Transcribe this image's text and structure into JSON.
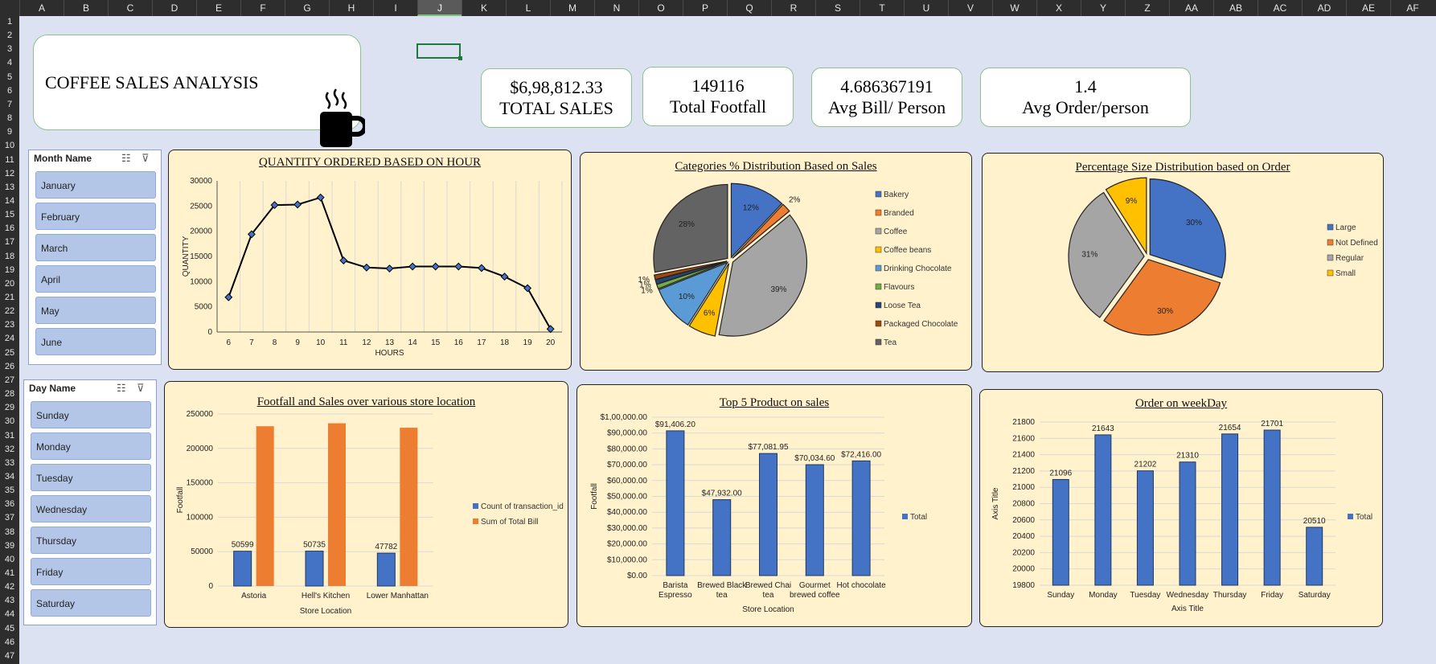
{
  "sheet": {
    "columns": [
      "A",
      "B",
      "C",
      "D",
      "E",
      "F",
      "G",
      "H",
      "I",
      "J",
      "K",
      "L",
      "M",
      "N",
      "O",
      "P",
      "Q",
      "R",
      "S",
      "T",
      "U",
      "V",
      "W",
      "X",
      "Y",
      "Z",
      "AA",
      "AB",
      "AC",
      "AD",
      "AE",
      "AF"
    ],
    "selected_column": "J",
    "rows": [
      "1",
      "2",
      "3",
      "4",
      "5",
      "6",
      "7",
      "8",
      "9",
      "10",
      "11",
      "12",
      "13",
      "14",
      "15",
      "16",
      "17",
      "18",
      "19",
      "20",
      "21",
      "22",
      "23",
      "24",
      "25",
      "26",
      "27",
      "28",
      "29",
      "30",
      "31",
      "32",
      "33",
      "34",
      "35",
      "36",
      "37",
      "38",
      "39",
      "40",
      "41",
      "42",
      "43",
      "44",
      "45",
      "46",
      "47"
    ]
  },
  "dashboard": {
    "title": "COFFEE SALES ANALYSIS",
    "icon": "coffee-mug-icon"
  },
  "kpis": [
    {
      "value": "$6,98,812.33",
      "label": "TOTAL SALES"
    },
    {
      "value": "149116",
      "label": "Total Footfall"
    },
    {
      "value": "4.686367191",
      "label": "Avg Bill/ Person"
    },
    {
      "value": "1.4",
      "label": "Avg Order/person"
    }
  ],
  "slicers": {
    "month": {
      "header": "Month Name",
      "items": [
        "January",
        "February",
        "March",
        "April",
        "May",
        "June"
      ]
    },
    "day": {
      "header": "Day Name",
      "items": [
        "Sunday",
        "Monday",
        "Tuesday",
        "Wednesday",
        "Thursday",
        "Friday",
        "Saturday"
      ]
    }
  },
  "colors": {
    "panel_bg": "#fff2cc",
    "blue": "#4472c4",
    "orange": "#ed7d31",
    "gray": "#a5a5a5",
    "yellow": "#ffc000",
    "light_blue": "#5b9bd5",
    "green": "#70ad47",
    "navy": "#264478",
    "dark_orange": "#9e480e",
    "dark_gray": "#636363"
  },
  "chart_data": [
    {
      "type": "line",
      "title": "QUANTITY ORDERED BASED ON HOUR",
      "xlabel": "HOURS",
      "ylabel": "QUANTITY",
      "x": [
        6,
        7,
        8,
        9,
        10,
        11,
        12,
        13,
        14,
        15,
        16,
        17,
        18,
        19,
        20
      ],
      "y": [
        6900,
        19400,
        25200,
        25300,
        26700,
        14200,
        12800,
        12600,
        13000,
        13000,
        13000,
        12700,
        11000,
        8700,
        600
      ],
      "ylim": [
        0,
        30000
      ],
      "yticks": [
        "0",
        "5000",
        "10000",
        "15000",
        "20000",
        "25000",
        "30000"
      ],
      "grid": "vertical"
    },
    {
      "type": "pie",
      "title": "Categories %  Distribution Based on Sales",
      "labels": [
        "Bakery",
        "Branded",
        "Coffee",
        "Coffee beans",
        "Drinking Chocolate",
        "Flavours",
        "Loose Tea",
        "Packaged Chocolate",
        "Tea"
      ],
      "values": [
        12,
        2,
        39,
        6,
        10,
        1,
        1,
        1,
        28
      ],
      "data_labels": [
        "12%",
        "2%",
        "39%",
        "6%",
        "10%",
        "1%",
        "1%",
        "1%",
        "28%"
      ],
      "legend": "right"
    },
    {
      "type": "pie",
      "title": "Percentage Size Distribution based on Order",
      "labels": [
        "Large",
        "Not Defined",
        "Regular",
        "Small"
      ],
      "values": [
        30,
        30,
        31,
        9
      ],
      "data_labels": [
        "30%",
        "30%",
        "31%",
        "9%"
      ],
      "legend": "right"
    },
    {
      "type": "bar",
      "title": "Footfall and Sales over various store location",
      "categories": [
        "Astoria",
        "Hell's Kitchen",
        "Lower Manhattan"
      ],
      "series": [
        {
          "name": "Count of transaction_id",
          "values": [
            50599,
            50735,
            47782
          ],
          "labels": [
            "50599",
            "50735",
            "47782"
          ]
        },
        {
          "name": "Sum of Total Bill",
          "values": [
            232244,
            236511,
            230057
          ]
        }
      ],
      "xlabel": "Store Location",
      "ylabel": "Footfall",
      "ylim": [
        0,
        250000
      ],
      "yticks": [
        "0",
        "50000",
        "100000",
        "150000",
        "200000",
        "250000"
      ],
      "legend": "right"
    },
    {
      "type": "bar",
      "title": "Top 5 Product on sales",
      "categories": [
        "Barista Espresso",
        "Brewed Black tea",
        "Brewed Chai tea",
        "Gourmet brewed coffee",
        "Hot chocolate"
      ],
      "category_lines": [
        [
          "Barista",
          "Espresso"
        ],
        [
          "Brewed Black",
          "tea"
        ],
        [
          "Brewed Chai",
          "tea"
        ],
        [
          "Gourmet",
          "brewed coffee"
        ],
        [
          "Hot chocolate",
          ""
        ]
      ],
      "series": [
        {
          "name": "Total",
          "values": [
            91406.2,
            47932.0,
            77081.95,
            70034.6,
            72416.0
          ],
          "labels": [
            "$91,406.20",
            "$47,932.00",
            "$77,081.95",
            "$70,034.60",
            "$72,416.00"
          ]
        }
      ],
      "xlabel": "Store Location",
      "ylabel": "Footfall",
      "ylim": [
        0,
        100000
      ],
      "yticks": [
        "$0.00",
        "$10,000.00",
        "$20,000.00",
        "$30,000.00",
        "$40,000.00",
        "$50,000.00",
        "$60,000.00",
        "$70,000.00",
        "$80,000.00",
        "$90,000.00",
        "$1,00,000.00"
      ],
      "legend": "right"
    },
    {
      "type": "bar",
      "title": "Order on weekDay",
      "categories": [
        "Sunday",
        "Monday",
        "Tuesday",
        "Wednesday",
        "Thursday",
        "Friday",
        "Saturday"
      ],
      "series": [
        {
          "name": "Total",
          "values": [
            21096,
            21643,
            21202,
            21310,
            21654,
            21701,
            20510
          ],
          "labels": [
            "21096",
            "21643",
            "21202",
            "21310",
            "21654",
            "21701",
            "20510"
          ]
        }
      ],
      "xlabel": "Axis Title",
      "ylabel": "Axis Title",
      "ylim": [
        19800,
        21800
      ],
      "yticks": [
        "19800",
        "20000",
        "20200",
        "20400",
        "20600",
        "20800",
        "21000",
        "21200",
        "21400",
        "21600",
        "21800"
      ],
      "legend": "right"
    }
  ]
}
